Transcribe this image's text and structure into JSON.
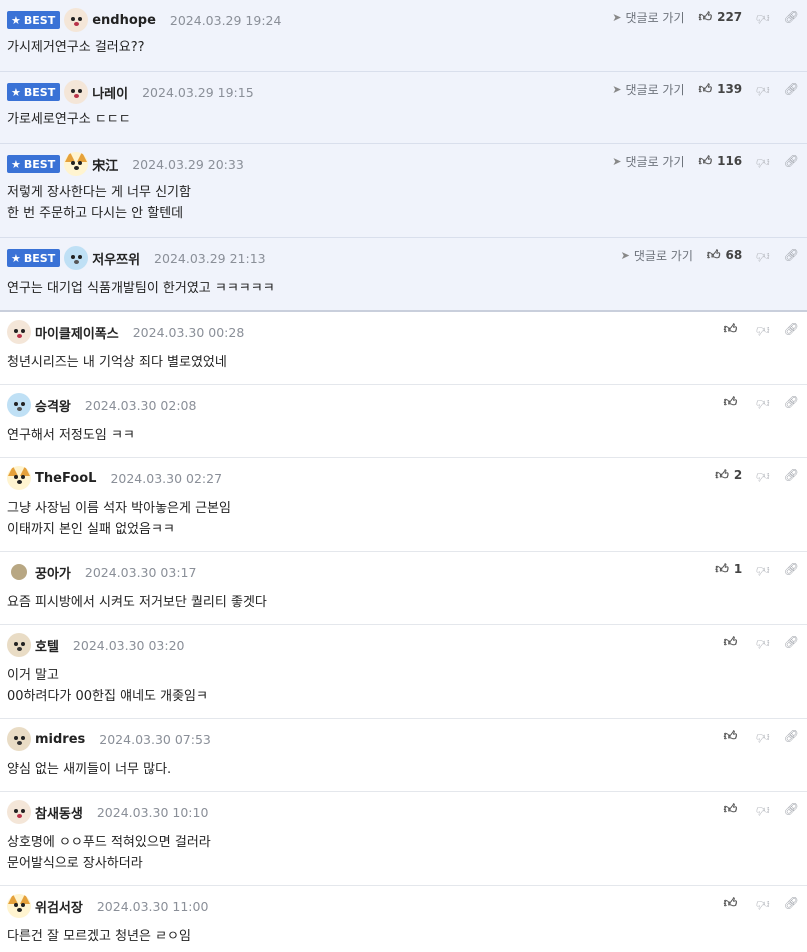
{
  "labels": {
    "best": "BEST",
    "reply_go": "댓글로 가기"
  },
  "icons": {
    "star": "star-icon",
    "reply_arrow": "send-arrow-icon",
    "like": "thumbs-up-icon",
    "dislike": "thumbs-down-icon",
    "link": "link-icon"
  },
  "colors": {
    "best_badge": "#3a72d6",
    "best_bg": "#f0f3fb",
    "date": "#8a8f98"
  },
  "best_comments": [
    {
      "nick": "endhope",
      "date": "2024.03.29 19:24",
      "likes": "227",
      "lines": [
        "가시제거연구소 걸러요??"
      ]
    },
    {
      "nick": "나레이",
      "date": "2024.03.29 19:15",
      "likes": "139",
      "lines": [
        "가로세로연구소 ㄷㄷㄷ"
      ]
    },
    {
      "nick": "宋江",
      "date": "2024.03.29 20:33",
      "likes": "116",
      "lines": [
        "저렇게 장사한다는 게 너무 신기함",
        "한 번 주문하고 다시는 안 할텐데"
      ]
    },
    {
      "nick": "저우쯔위",
      "date": "2024.03.29 21:13",
      "likes": "68",
      "lines": [
        "연구는 대기업 식품개발팀이 한거였고 ㅋㅋㅋㅋㅋ"
      ]
    }
  ],
  "comments": [
    {
      "nick": "마이클제이폭스",
      "date": "2024.03.30 00:28",
      "likes": "",
      "lines": [
        "청년시리즈는 내 기억상 죄다 별로였었네"
      ]
    },
    {
      "nick": "승격왕",
      "date": "2024.03.30 02:08",
      "likes": "",
      "lines": [
        "연구해서 저정도임 ㅋㅋ"
      ]
    },
    {
      "nick": "TheFooL",
      "date": "2024.03.30 02:27",
      "likes": "2",
      "lines": [
        "그냥 사장님 이름 석자 박아놓은게 근본임",
        "이태까지 본인 실패 없었음ㅋㅋ"
      ]
    },
    {
      "nick": "꿍아가",
      "date": "2024.03.30 03:17",
      "likes": "1",
      "lines": [
        "요즘 피시방에서 시켜도 저거보단 퀄리티 좋겟다"
      ]
    },
    {
      "nick": "호텔",
      "date": "2024.03.30 03:20",
      "likes": "",
      "lines": [
        "이거 말고",
        "00하려다가 00한집 얘네도 개좆임ㅋ"
      ]
    },
    {
      "nick": "midres",
      "date": "2024.03.30 07:53",
      "likes": "",
      "lines": [
        "양심 없는 새끼들이 너무 많다."
      ]
    },
    {
      "nick": "참새동생",
      "date": "2024.03.30 10:10",
      "likes": "",
      "lines": [
        "상호명에 ㅇㅇ푸드 적혀있으면 걸러라",
        "문어발식으로 장사하더라"
      ]
    },
    {
      "nick": "위검서장",
      "date": "2024.03.30 11:00",
      "likes": "",
      "lines": [
        "다른건 잘 모르겠고 청년은 ㄹㅇ임"
      ]
    }
  ]
}
